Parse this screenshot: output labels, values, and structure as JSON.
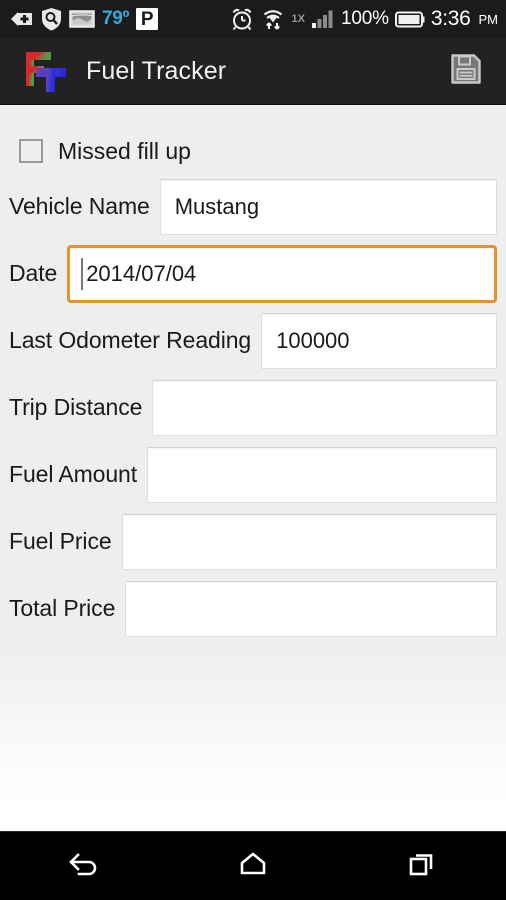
{
  "status_bar": {
    "icons": [
      {
        "name": "back-plus-icon",
        "label": ""
      },
      {
        "name": "shield-search-icon",
        "label": ""
      },
      {
        "name": "weather-image-icon",
        "label": ""
      }
    ],
    "temperature": "79º",
    "parking_label": "P",
    "alarm_icon": "alarm-clock-icon",
    "wifi_icon": "wifi-data-transfer-icon",
    "network_type": "1X",
    "signal_icon": "cellular-signal-icon",
    "battery_percent": "100%",
    "battery_icon": "battery-full-icon",
    "time": "3:36",
    "ampm": "PM"
  },
  "app_bar": {
    "logo_name": "fuel-tracker-logo",
    "logo_letters": {
      "f": "F",
      "t": "T"
    },
    "title": "Fuel Tracker",
    "save_label": "Save",
    "save_icon": "floppy-disk-save-icon"
  },
  "form": {
    "missed_fillup": {
      "label": "Missed fill up",
      "checked": false
    },
    "fields": [
      {
        "name": "vehicle-name",
        "label": "Vehicle Name",
        "value": "Mustang",
        "placeholder": "",
        "focused": false
      },
      {
        "name": "date",
        "label": "Date",
        "value": "2014/07/04",
        "placeholder": "",
        "focused": true
      },
      {
        "name": "last-odometer-reading",
        "label": "Last Odometer Reading",
        "value": "100000",
        "placeholder": "",
        "focused": false
      },
      {
        "name": "trip-distance",
        "label": "Trip Distance",
        "value": "",
        "placeholder": "",
        "focused": false
      },
      {
        "name": "fuel-amount",
        "label": "Fuel Amount",
        "value": "",
        "placeholder": "",
        "focused": false
      },
      {
        "name": "fuel-price",
        "label": "Fuel Price",
        "value": "",
        "placeholder": "",
        "focused": false
      },
      {
        "name": "total-price",
        "label": "Total Price",
        "value": "",
        "placeholder": "",
        "focused": false
      }
    ]
  },
  "nav_bar": {
    "back": "back-icon",
    "home": "home-icon",
    "recents": "recent-apps-icon"
  },
  "colors": {
    "accent_focus": "#e8912d",
    "status_bar_bg": "#1b1b1b",
    "app_bar_bg": "#222222",
    "form_bg": "#eeeeee",
    "temp_blue": "#35a8dd"
  }
}
